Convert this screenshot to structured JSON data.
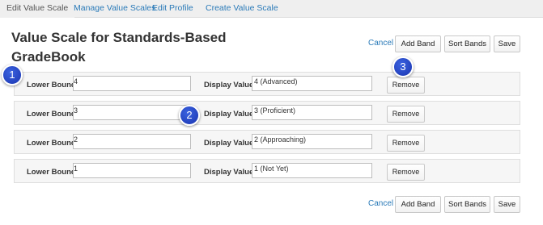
{
  "nav": {
    "tabs": [
      {
        "label": "Edit Value Scale",
        "active": true
      },
      {
        "label": "Manage Value Scales",
        "active": false
      },
      {
        "label": "Edit Profile",
        "active": false
      },
      {
        "label": "Create Value Scale",
        "active": false
      }
    ]
  },
  "page_title": "Value Scale for Standards-Based GradeBook",
  "actions": {
    "cancel_label": "Cancel",
    "add_band_label": "Add Band",
    "sort_bands_label": "Sort Bands",
    "save_label": "Save"
  },
  "band_labels": {
    "lower_bound": "Lower Bound",
    "display_value": "Display Value",
    "remove": "Remove"
  },
  "bands": [
    {
      "lower_bound": "4",
      "display_value": "4 (Advanced)"
    },
    {
      "lower_bound": "3",
      "display_value": "3 (Proficient)"
    },
    {
      "lower_bound": "2",
      "display_value": "2 (Approaching)"
    },
    {
      "lower_bound": "1",
      "display_value": "1 (Not Yet)"
    }
  ],
  "callouts": [
    "1",
    "2",
    "3"
  ],
  "colors": {
    "link": "#2a7ab8",
    "callout": "#1f3fc4",
    "nav_bg": "#efefef",
    "band_bg": "#f6f6f6"
  }
}
